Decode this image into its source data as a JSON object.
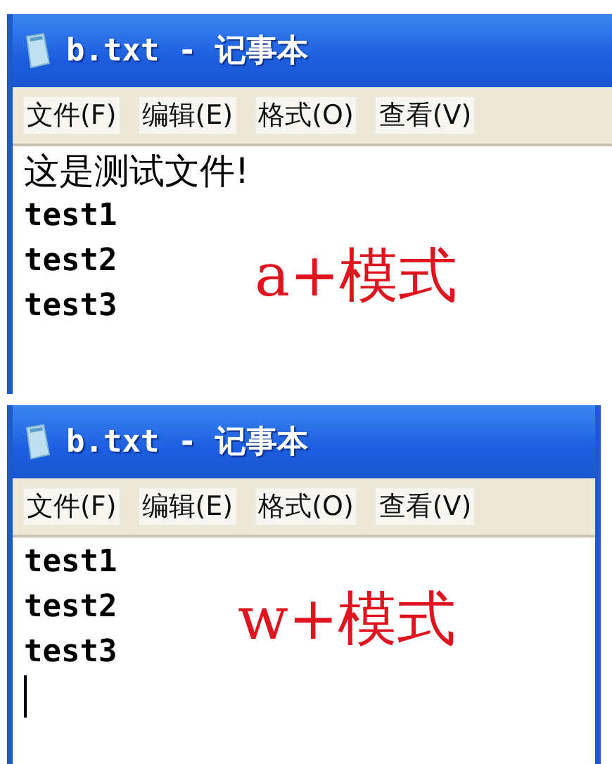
{
  "windows": [
    {
      "title": "b.txt - 记事本",
      "menu": [
        "文件(F)",
        "编辑(E)",
        "格式(O)",
        "查看(V)"
      ],
      "lines": [
        {
          "text": "这是测试文件!",
          "kind": "chinese"
        },
        {
          "text": "test1",
          "kind": "ascii"
        },
        {
          "text": "test2",
          "kind": "ascii"
        },
        {
          "text": "test3",
          "kind": "ascii"
        }
      ],
      "annotation": "a+模式",
      "caret": false
    },
    {
      "title": "b.txt - 记事本",
      "menu": [
        "文件(F)",
        "编辑(E)",
        "格式(O)",
        "查看(V)"
      ],
      "lines": [
        {
          "text": "test1",
          "kind": "ascii"
        },
        {
          "text": "test2",
          "kind": "ascii"
        },
        {
          "text": "test3",
          "kind": "ascii"
        }
      ],
      "annotation": "w+模式",
      "caret": true
    }
  ]
}
